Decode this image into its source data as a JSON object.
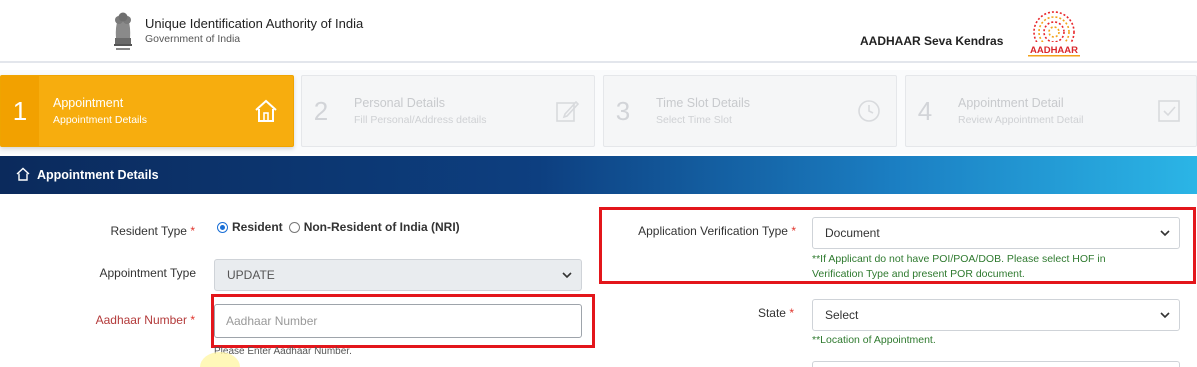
{
  "header": {
    "org_name": "Unique Identification Authority of India",
    "org_sub": "Government of India",
    "seva_label": "AADHAAR Seva Kendras",
    "logo_text": "AADHAAR"
  },
  "stepper": {
    "steps": [
      {
        "num": "1",
        "title": "Appointment",
        "subtitle": "Appointment Details",
        "icon": "home-icon",
        "active": true
      },
      {
        "num": "2",
        "title": "Personal Details",
        "subtitle": "Fill Personal/Address details",
        "icon": "edit-icon",
        "active": false
      },
      {
        "num": "3",
        "title": "Time Slot Details",
        "subtitle": "Select Time Slot",
        "icon": "clock-icon",
        "active": false
      },
      {
        "num": "4",
        "title": "Appointment Detail",
        "subtitle": "Review Appointment Detail",
        "icon": "check-icon",
        "active": false
      }
    ]
  },
  "banner": {
    "title": "Appointment Details"
  },
  "form": {
    "resident_type": {
      "label": "Resident Type",
      "required": "*",
      "options": [
        "Resident",
        "Non-Resident of India (NRI)"
      ],
      "selected": "Resident"
    },
    "appointment_type": {
      "label": "Appointment Type",
      "value": "UPDATE"
    },
    "aadhaar_number": {
      "label": "Aadhaar Number",
      "required": "*",
      "placeholder": "Aadhaar Number",
      "hint": "Please Enter Aadhaar Number."
    },
    "verification_type": {
      "label": "Application Verification Type",
      "required": "*",
      "value": "Document",
      "hint_line1": "**If Applicant do not have POI/POA/DOB. Please select HOF in",
      "hint_line2": "Verification Type and present POR document."
    },
    "state": {
      "label": "State",
      "required": "*",
      "value": "Select",
      "hint": "**Location of Appointment."
    }
  },
  "colors": {
    "active_step": "#f7ad0e",
    "banner_start": "#0b2a5c",
    "banner_end": "#2bb5e6",
    "highlight_box": "#e3161b",
    "hint_green": "#2f7a2f"
  }
}
